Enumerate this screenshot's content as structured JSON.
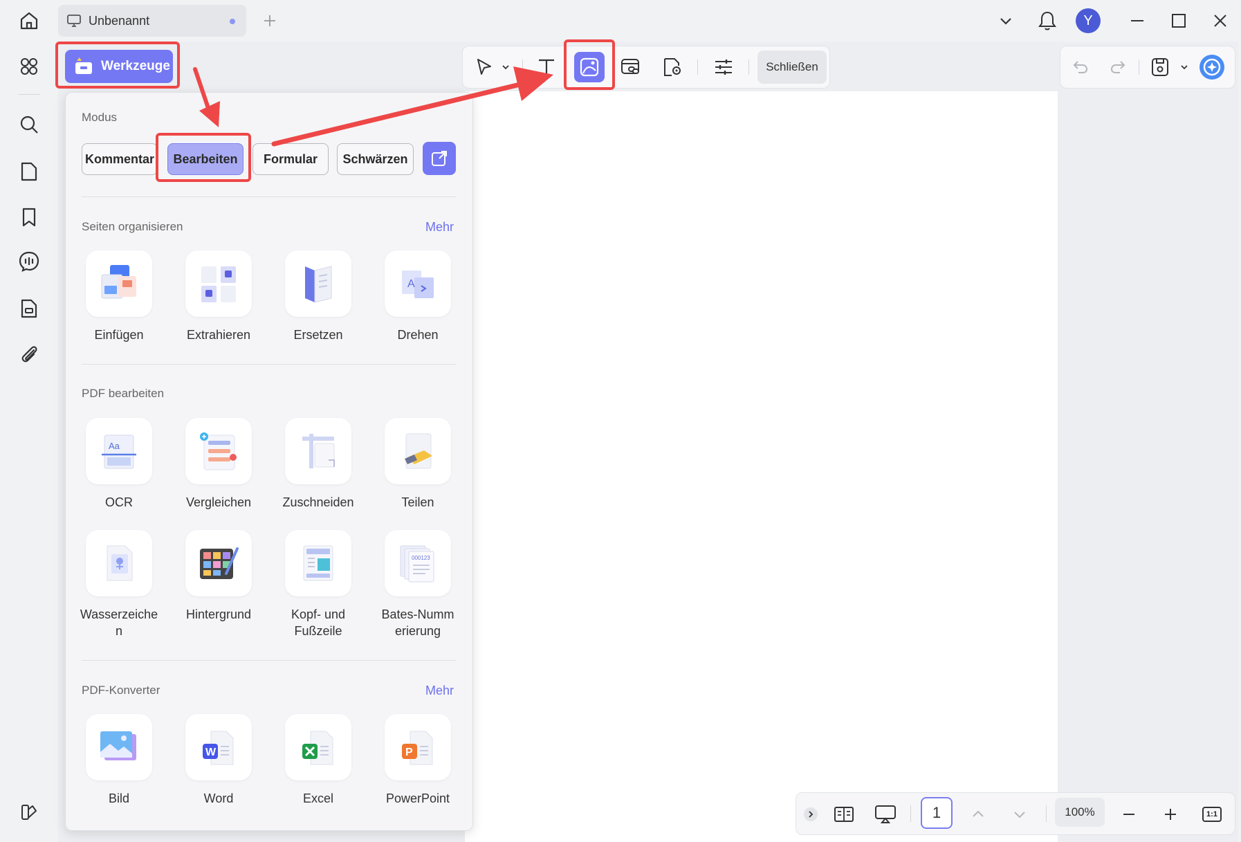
{
  "titlebar": {
    "tab_title": "Unbenannt",
    "avatar_initial": "Y"
  },
  "toolbar": {
    "werkzeuge_label": "Werkzeuge",
    "close_label": "Schließen"
  },
  "panel": {
    "mode_section_title": "Modus",
    "modes": [
      {
        "label": "Kommentar",
        "selected": false
      },
      {
        "label": "Bearbeiten",
        "selected": true
      },
      {
        "label": "Formular",
        "selected": false
      },
      {
        "label": "Schwärzen",
        "selected": false
      }
    ],
    "organize": {
      "title": "Seiten organisieren",
      "more": "Mehr",
      "tools": [
        "Einfügen",
        "Extrahieren",
        "Ersetzen",
        "Drehen"
      ]
    },
    "edit": {
      "title": "PDF bearbeiten",
      "tools": [
        "OCR",
        "Vergleichen",
        "Zuschneiden",
        "Teilen",
        "Wasserzeiche\nn",
        "Hintergrund",
        "Kopf- und\nFußzeile",
        "Bates-Numm\nerierung"
      ]
    },
    "converter": {
      "title": "PDF-Konverter",
      "more": "Mehr",
      "tools": [
        "Bild",
        "Word",
        "Excel",
        "PowerPoint"
      ]
    }
  },
  "bottombar": {
    "page_number": "1",
    "zoom": "100%",
    "actual_size": "1:1"
  },
  "colors": {
    "accent": "#7578f3",
    "annotation_red": "#ee4747",
    "selected_mode": "#a9acf4"
  },
  "icons": [
    "home-icon",
    "monitor-icon",
    "plus-icon",
    "chevron-down-icon",
    "bell-icon",
    "minimize-icon",
    "maximize-icon",
    "close-icon",
    "grid-icon",
    "search-icon",
    "page-icon",
    "bookmark-icon",
    "ai-chat-icon",
    "form-icon",
    "attachment-icon",
    "theme-icon",
    "cursor-icon",
    "text-icon",
    "image-edit-icon",
    "link-icon",
    "stamp-icon",
    "sliders-icon",
    "undo-icon",
    "redo-icon",
    "save-icon",
    "ai-assistant-icon",
    "expand-icon",
    "reading-mode-icon",
    "presentation-icon",
    "arrow-up-icon",
    "arrow-down-icon",
    "zoom-out-icon",
    "zoom-in-icon"
  ]
}
